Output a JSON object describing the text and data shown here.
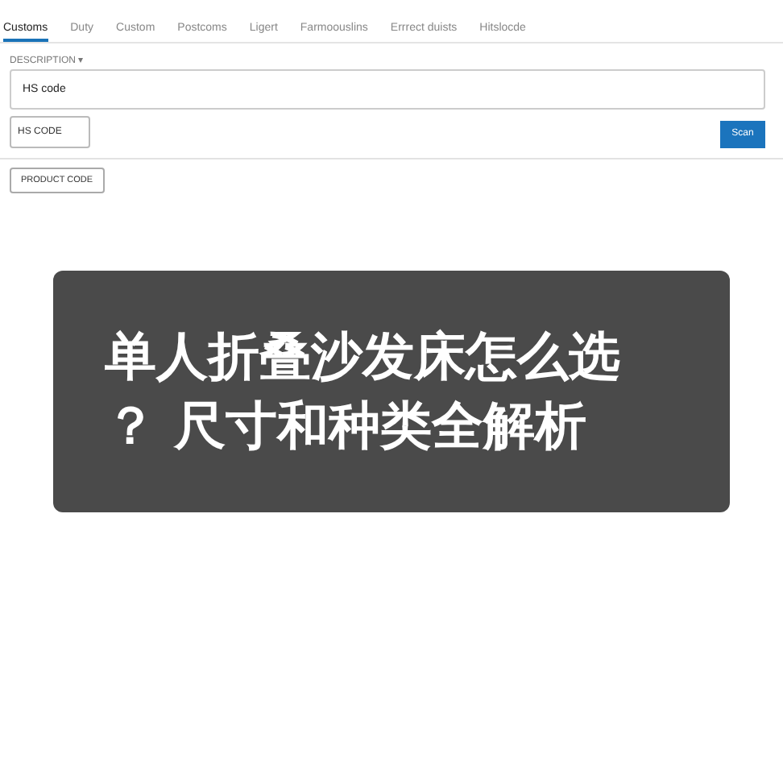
{
  "tabs": [
    {
      "label": "Customs",
      "selected": true
    },
    {
      "label": "Duty",
      "selected": false
    },
    {
      "label": "Custom",
      "selected": false
    },
    {
      "label": "Postcoms",
      "selected": false
    },
    {
      "label": "Ligert",
      "selected": false
    },
    {
      "label": "Farmoouslins",
      "selected": false
    },
    {
      "label": "Errrect duists",
      "selected": false
    },
    {
      "label": "Hitslocde",
      "selected": false
    }
  ],
  "section_label": "DESCRIPTION ▾",
  "description_field": {
    "value": "HS code"
  },
  "code_field": {
    "value": "HS CODE"
  },
  "scan_button": "Scan",
  "product_button": "PRODUCT CODE",
  "overlay": {
    "lines": [
      "单人折叠沙发床怎么选",
      "？ 尺寸和种类全解析"
    ]
  }
}
